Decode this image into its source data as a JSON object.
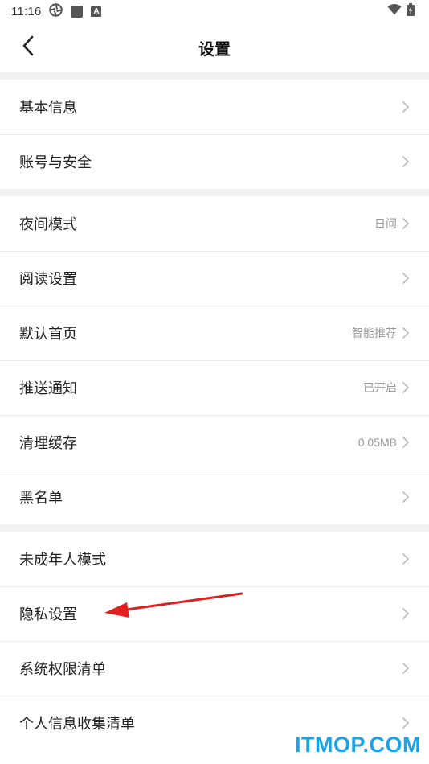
{
  "status_bar": {
    "time": "11:16",
    "icons": [
      "aperture-icon",
      "square-icon",
      "a-icon",
      "wifi-icon",
      "battery-charging-icon"
    ],
    "a_icon_letter": "A"
  },
  "header": {
    "title": "设置",
    "back_icon": "chevron-left-icon"
  },
  "sections": [
    {
      "items": [
        {
          "label": "基本信息",
          "value": ""
        },
        {
          "label": "账号与安全",
          "value": ""
        }
      ]
    },
    {
      "items": [
        {
          "label": "夜间模式",
          "value": "日间"
        },
        {
          "label": "阅读设置",
          "value": ""
        },
        {
          "label": "默认首页",
          "value": "智能推荐"
        },
        {
          "label": "推送通知",
          "value": "已开启"
        },
        {
          "label": "清理缓存",
          "value": "0.05MB"
        },
        {
          "label": "黑名单",
          "value": ""
        }
      ]
    },
    {
      "items": [
        {
          "label": "未成年人模式",
          "value": ""
        },
        {
          "label": "隐私设置",
          "value": ""
        },
        {
          "label": "系统权限清单",
          "value": ""
        },
        {
          "label": "个人信息收集清单",
          "value": ""
        }
      ]
    }
  ],
  "annotation": {
    "type": "red-arrow",
    "points_to": "隐私设置",
    "color": "#e02020"
  },
  "watermark": {
    "text": "ITMOP.COM",
    "color": "#1aa3e6"
  },
  "colors": {
    "section_gap": "#f2f2f2",
    "divider": "#ececec",
    "value_text": "#9a9a9a",
    "chevron": "#bdbdbd"
  }
}
